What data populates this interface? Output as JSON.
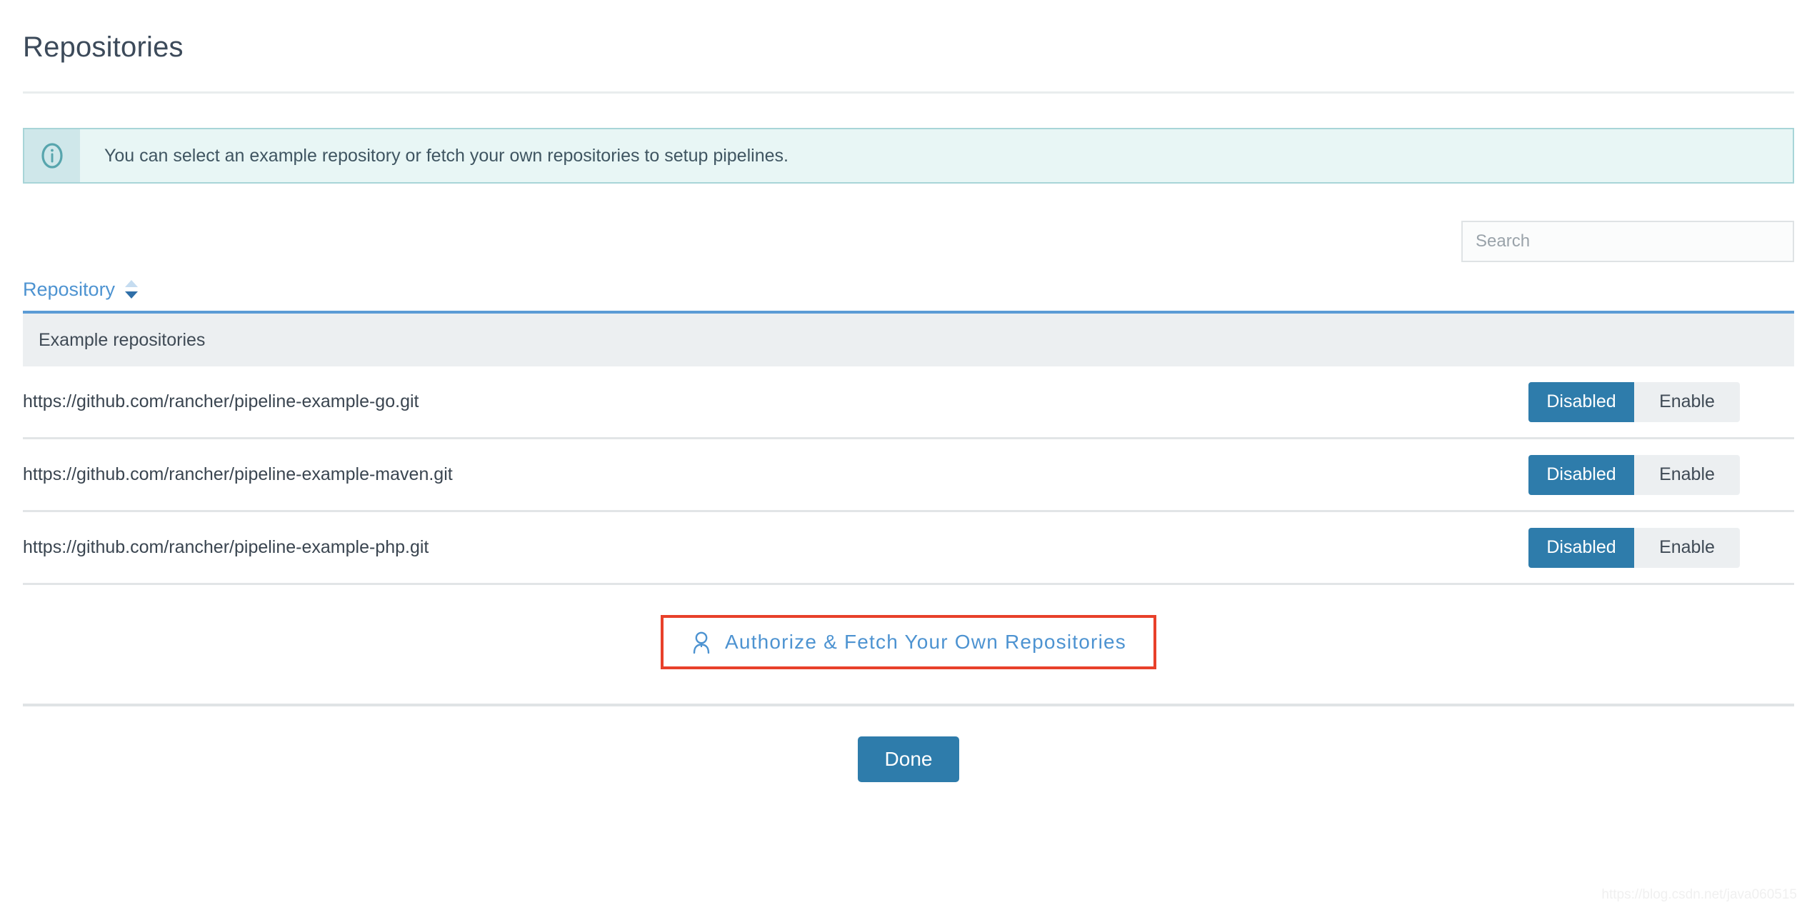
{
  "page": {
    "title": "Repositories",
    "watermark": "https://blog.csdn.net/java060515"
  },
  "banner": {
    "icon": "info-circle-icon",
    "message": "You can select an example repository or fetch your own repositories to setup pipelines.",
    "background_color": "#e8f6f5",
    "border_color": "#a8d5d8",
    "icon_cell_color": "#cfe7ea",
    "icon_color": "#57a5ad"
  },
  "search": {
    "placeholder": "Search",
    "value": ""
  },
  "table": {
    "column_header": {
      "label": "Repository",
      "sort_icon": "sort-chevrons-icon",
      "sort_state": "none"
    },
    "group_label": "Example repositories",
    "group_accent_color": "#5b9bd5",
    "rows": [
      {
        "url": "https://github.com/rancher/pipeline-example-go.git",
        "state_label": "Disabled",
        "action_label": "Enable",
        "active": "Disabled"
      },
      {
        "url": "https://github.com/rancher/pipeline-example-maven.git",
        "state_label": "Disabled",
        "action_label": "Enable",
        "active": "Disabled"
      },
      {
        "url": "https://github.com/rancher/pipeline-example-php.git",
        "state_label": "Disabled",
        "action_label": "Enable",
        "active": "Disabled"
      }
    ]
  },
  "authorize": {
    "icon": "user-icon",
    "label": "Authorize & Fetch Your Own Repositories",
    "highlight_color": "#e8402a",
    "link_color": "#4d93d1"
  },
  "footer": {
    "done_label": "Done",
    "accent_color": "#2e7cab"
  }
}
